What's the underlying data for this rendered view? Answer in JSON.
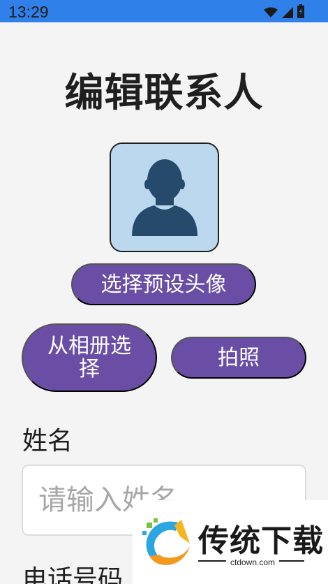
{
  "status_bar": {
    "time": "13:29",
    "icons": [
      "wifi-icon",
      "signal-icon",
      "battery-icon"
    ],
    "color": "#2f80e8"
  },
  "header": {
    "title": "编辑联系人"
  },
  "avatar": {
    "icon": "person-silhouette-icon",
    "background": "#bcd8ee"
  },
  "actions": {
    "preset_label": "选择预设头像",
    "album_label": "从相册选择",
    "camera_label": "拍照",
    "accent": "#6a4ea6"
  },
  "form": {
    "name_label": "姓名",
    "name_value": "",
    "name_placeholder": "请输入姓名",
    "phone_label": "电话号码"
  },
  "watermark": {
    "brand": "传统下载",
    "url": "ctdown.com"
  }
}
